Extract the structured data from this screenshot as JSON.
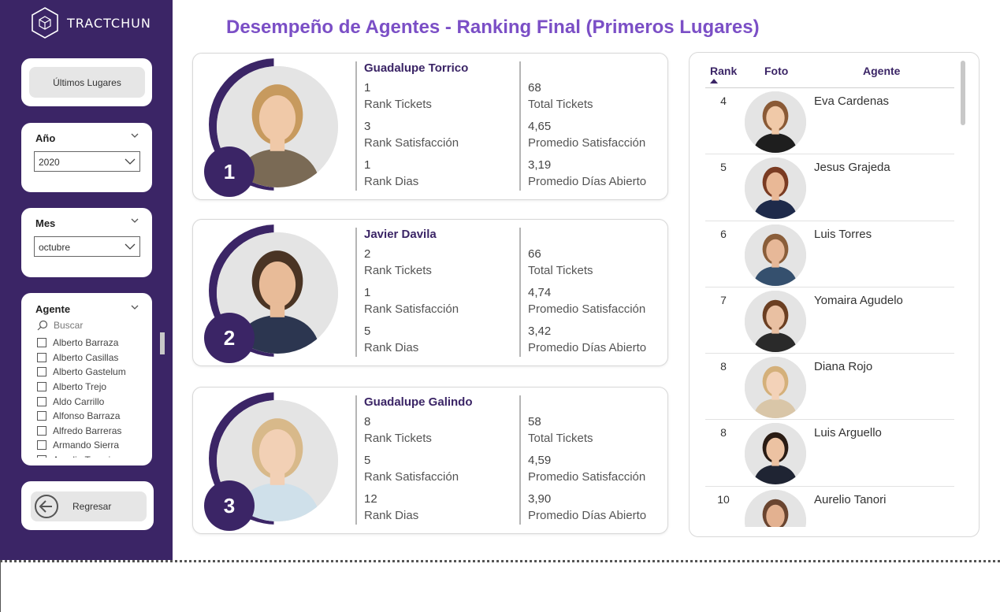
{
  "app": {
    "brand": "TRACTCHUN"
  },
  "page": {
    "title": "Desempeño de Agentes - Ranking Final (Primeros Lugares)"
  },
  "sidebar": {
    "ultimos_button": "Últimos Lugares",
    "year": {
      "label": "Año",
      "value": "2020"
    },
    "month": {
      "label": "Mes",
      "value": "octubre"
    },
    "agent": {
      "label": "Agente",
      "search_placeholder": "Buscar",
      "items": [
        "Alberto Barraza",
        "Alberto Casillas",
        "Alberto Gastelum",
        "Alberto Trejo",
        "Aldo Carrillo",
        "Alfonso Barraza",
        "Alfredo Barreras",
        "Armando Sierra",
        "Aurelio Tanori"
      ]
    },
    "back_button": "Regresar"
  },
  "top_agents": [
    {
      "position": "1",
      "name": "Guadalupe Torrico",
      "rank_tickets": "1",
      "rank_tickets_label": "Rank Tickets",
      "rank_satisfaccion": "3",
      "rank_satisfaccion_label": "Rank Satisfacción",
      "rank_dias": "1",
      "rank_dias_label": "Rank Dias",
      "total_tickets": "68",
      "total_tickets_label": "Total Tickets",
      "promedio_satisfaccion": "4,65",
      "promedio_satisfaccion_label": "Promedio Satisfacción",
      "promedio_dias": "3,19",
      "promedio_dias_label": "Promedio Días Abierto"
    },
    {
      "position": "2",
      "name": "Javier Davila",
      "rank_tickets": "2",
      "rank_tickets_label": "Rank Tickets",
      "rank_satisfaccion": "1",
      "rank_satisfaccion_label": "Rank Satisfacción",
      "rank_dias": "5",
      "rank_dias_label": "Rank Dias",
      "total_tickets": "66",
      "total_tickets_label": "Total Tickets",
      "promedio_satisfaccion": "4,74",
      "promedio_satisfaccion_label": "Promedio Satisfacción",
      "promedio_dias": "3,42",
      "promedio_dias_label": "Promedio Días Abierto"
    },
    {
      "position": "3",
      "name": "Guadalupe Galindo",
      "rank_tickets": "8",
      "rank_tickets_label": "Rank Tickets",
      "rank_satisfaccion": "5",
      "rank_satisfaccion_label": "Rank Satisfacción",
      "rank_dias": "12",
      "rank_dias_label": "Rank Dias",
      "total_tickets": "58",
      "total_tickets_label": "Total Tickets",
      "promedio_satisfaccion": "4,59",
      "promedio_satisfaccion_label": "Promedio Satisfacción",
      "promedio_dias": "3,90",
      "promedio_dias_label": "Promedio Días Abierto"
    }
  ],
  "ranking_table": {
    "headers": {
      "rank": "Rank",
      "foto": "Foto",
      "agente": "Agente"
    },
    "rows": [
      {
        "rank": "4",
        "agente": "Eva Cardenas"
      },
      {
        "rank": "5",
        "agente": "Jesus Grajeda"
      },
      {
        "rank": "6",
        "agente": "Luis Torres"
      },
      {
        "rank": "7",
        "agente": "Yomaira Agudelo"
      },
      {
        "rank": "8",
        "agente": "Diana Rojo"
      },
      {
        "rank": "8",
        "agente": "Luis Arguello"
      },
      {
        "rank": "10",
        "agente": "Aurelio Tanori"
      }
    ]
  },
  "colors": {
    "brand_purple": "#3b2566",
    "title_purple": "#7b4fc6"
  }
}
